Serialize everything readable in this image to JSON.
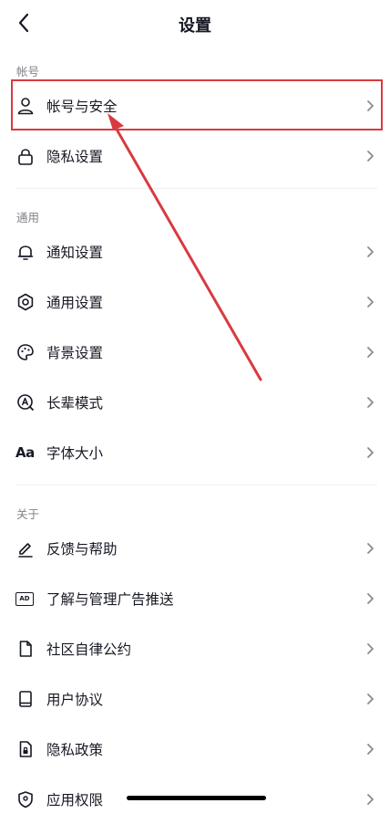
{
  "header": {
    "title": "设置"
  },
  "sections": [
    {
      "label": "帐号",
      "items": [
        {
          "label": "帐号与安全",
          "icon": "person-icon"
        },
        {
          "label": "隐私设置",
          "icon": "lock-icon"
        }
      ]
    },
    {
      "label": "通用",
      "items": [
        {
          "label": "通知设置",
          "icon": "bell-icon"
        },
        {
          "label": "通用设置",
          "icon": "gear-icon"
        },
        {
          "label": "背景设置",
          "icon": "palette-icon"
        },
        {
          "label": "长辈模式",
          "icon": "elder-mode-icon"
        },
        {
          "label": "字体大小",
          "icon": "font-size-icon",
          "icon_text": "Aa"
        }
      ]
    },
    {
      "label": "关于",
      "items": [
        {
          "label": "反馈与帮助",
          "icon": "pencil-icon"
        },
        {
          "label": "了解与管理广告推送",
          "icon": "ad-icon",
          "icon_text": "AD"
        },
        {
          "label": "社区自律公约",
          "icon": "document-icon"
        },
        {
          "label": "用户协议",
          "icon": "book-icon"
        },
        {
          "label": "隐私政策",
          "icon": "privacy-file-icon"
        },
        {
          "label": "应用权限",
          "icon": "shield-location-icon"
        }
      ]
    }
  ],
  "annotation": {
    "highlight_color": "#d93a3f"
  }
}
